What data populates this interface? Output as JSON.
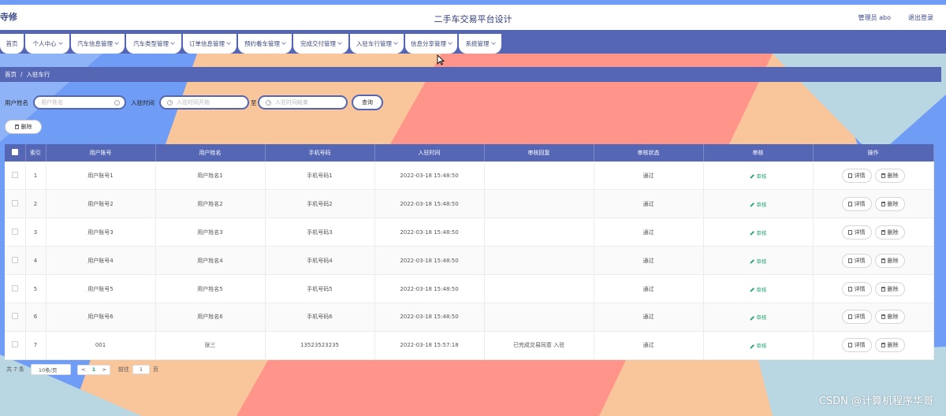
{
  "header": {
    "logo_text": "寺修",
    "title": "二手车交易平台设计",
    "admin_label": "管理员 abo",
    "logout_label": "退出登录"
  },
  "nav": {
    "items": [
      {
        "label": "首页",
        "has_dropdown": false
      },
      {
        "label": "个人中心",
        "has_dropdown": true
      },
      {
        "label": "汽车信息管理",
        "has_dropdown": true
      },
      {
        "label": "汽车类型管理",
        "has_dropdown": true
      },
      {
        "label": "订单信息管理",
        "has_dropdown": true
      },
      {
        "label": "预约看车管理",
        "has_dropdown": true
      },
      {
        "label": "完成交付管理",
        "has_dropdown": true
      },
      {
        "label": "入驻车行管理",
        "has_dropdown": true
      },
      {
        "label": "信息分享管理",
        "has_dropdown": true
      },
      {
        "label": "系统管理",
        "has_dropdown": true
      }
    ]
  },
  "breadcrumb": {
    "home": "首页",
    "separator": "/",
    "current": "入驻车行"
  },
  "search": {
    "username_label": "用户姓名",
    "username_placeholder": "用户姓名",
    "time_label": "入驻时间",
    "start_placeholder": "入驻时间开始",
    "to_label": "至",
    "end_placeholder": "入驻时间结束",
    "query_button": "查询"
  },
  "toolbar": {
    "delete_label": "删除"
  },
  "table": {
    "headers": [
      "",
      "索引",
      "用户账号",
      "用户姓名",
      "手机号码",
      "入驻时间",
      "审核回复",
      "审核状态",
      "审核",
      "操作"
    ],
    "audit_label": "审核",
    "detail_label": "详情",
    "delete_label": "删除",
    "rows": [
      {
        "index": "1",
        "account": "用户账号1",
        "name": "用户姓名1",
        "phone": "手机号码1",
        "time": "2022-03-18 15:48:50",
        "reply": "",
        "status": "通过"
      },
      {
        "index": "2",
        "account": "用户账号2",
        "name": "用户姓名2",
        "phone": "手机号码2",
        "time": "2022-03-18 15:48:50",
        "reply": "",
        "status": "通过"
      },
      {
        "index": "3",
        "account": "用户账号3",
        "name": "用户姓名3",
        "phone": "手机号码3",
        "time": "2022-03-18 15:48:50",
        "reply": "",
        "status": "通过"
      },
      {
        "index": "4",
        "account": "用户账号4",
        "name": "用户姓名4",
        "phone": "手机号码4",
        "time": "2022-03-18 15:48:50",
        "reply": "",
        "status": "通过"
      },
      {
        "index": "5",
        "account": "用户账号5",
        "name": "用户姓名5",
        "phone": "手机号码5",
        "time": "2022-03-18 15:48:50",
        "reply": "",
        "status": "通过"
      },
      {
        "index": "6",
        "account": "用户账号6",
        "name": "用户姓名6",
        "phone": "手机号码6",
        "time": "2022-03-18 15:48:50",
        "reply": "",
        "status": "通过"
      },
      {
        "index": "7",
        "account": "001",
        "name": "张三",
        "phone": "13523523235",
        "time": "2022-03-18 15:57:18",
        "reply": "已完成交易同意 入驻",
        "status": "通过"
      }
    ]
  },
  "pagination": {
    "total": "共 7 条",
    "page_size": "10条/页",
    "prev": "<",
    "current_page": "1",
    "next": ">",
    "goto_label": "前往",
    "goto_value": "1",
    "page_unit": "页"
  },
  "watermark": "CSDN @计算机程序华哥",
  "colors": {
    "primary": "#5567b4",
    "audit_green": "#2aa775",
    "bg_blue": "#6f9cf5",
    "bg_peach": "#f9c59b",
    "bg_salmon": "#ff958a"
  }
}
